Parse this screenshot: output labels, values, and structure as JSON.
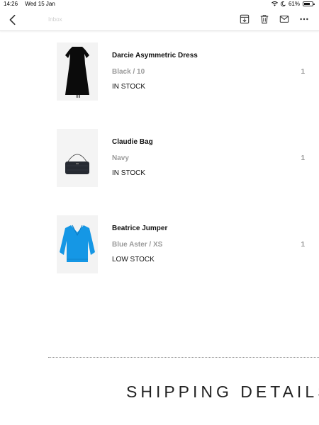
{
  "status": {
    "time": "14:26",
    "date": "Wed 15 Jan",
    "battery": "61%"
  },
  "toolbar": {
    "ghost_text": "Inbox"
  },
  "items": [
    {
      "name": "Darcie Asymmetric Dress",
      "variant": "Black / 10",
      "quantity": "1",
      "stock": "IN STOCK",
      "thumb_color": "#000000"
    },
    {
      "name": "Claudie Bag",
      "variant": "Navy",
      "quantity": "1",
      "stock": "IN STOCK",
      "thumb_color": "#2a2d34"
    },
    {
      "name": "Beatrice Jumper",
      "variant": "Blue Aster / XS",
      "quantity": "1",
      "stock": "LOW STOCK",
      "thumb_color": "#1597e5"
    }
  ],
  "section": {
    "shipping_title": "SHIPPING DETAILS"
  }
}
